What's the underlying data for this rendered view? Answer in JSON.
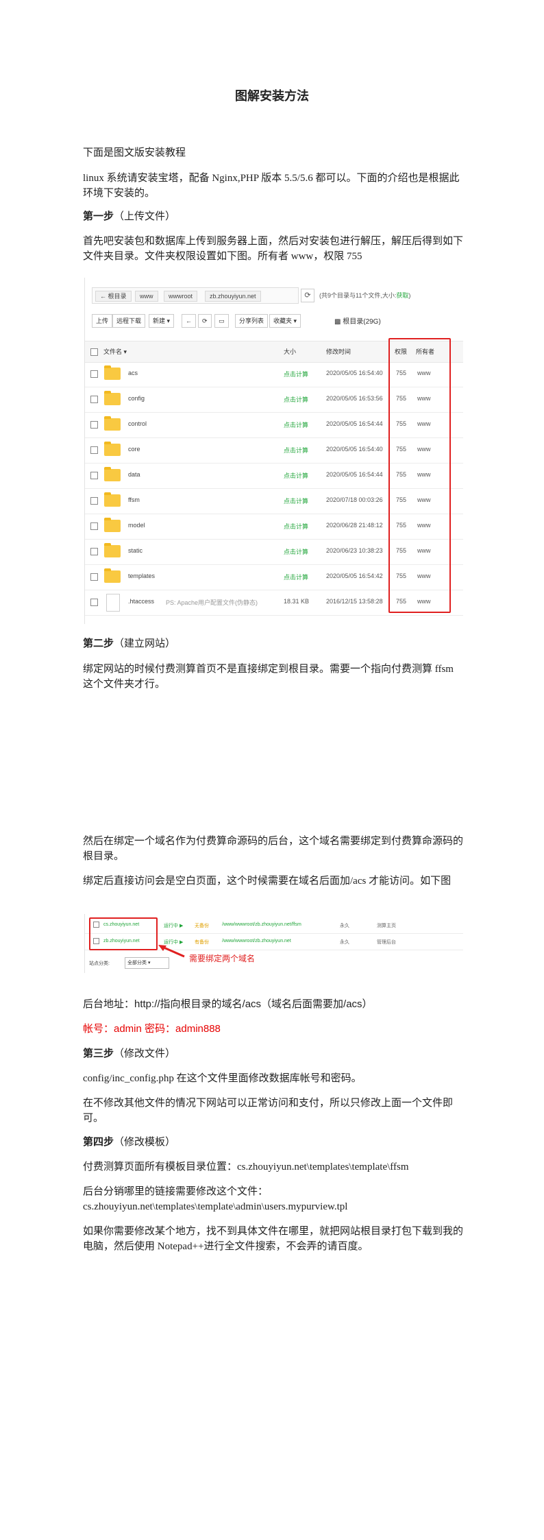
{
  "title": "图解安装方法",
  "intro": "下面是图文版安装教程",
  "env_line": "linux 系统请安装宝塔，配备 Nginx,PHP 版本 5.5/5.6 都可以。下面的介绍也是根据此环境下安装的。",
  "step1": {
    "label": "第一步",
    "sub": "（上传文件）",
    "desc": "首先吧安装包和数据库上传到服务器上面，然后对安装包进行解压，解压后得到如下文件夹目录。文件夹权限设置如下图。所有者 www，权限 755"
  },
  "file_manager": {
    "path": [
      "根目录",
      "www",
      "wwwroot",
      "zb.zhouyiyun.net"
    ],
    "summary_prefix": "(共9个目录与11个文件,大小:",
    "summary_link": "获取",
    "summary_suffix": ")",
    "toolbar": [
      "上传",
      "远程下载",
      "新建 ▾",
      "分享列表",
      "收藏夹 ▾"
    ],
    "disk": "根目录(29G)",
    "headers": {
      "name": "文件名",
      "size": "大小",
      "modified": "修改时间",
      "perm": "权限",
      "owner": "所有者"
    },
    "rows": [
      {
        "name": "acs",
        "size": "点击计算",
        "time": "2020/05/05 16:54:40",
        "perm": "755",
        "owner": "www"
      },
      {
        "name": "config",
        "size": "点击计算",
        "time": "2020/05/05 16:53:56",
        "perm": "755",
        "owner": "www"
      },
      {
        "name": "control",
        "size": "点击计算",
        "time": "2020/05/05 16:54:44",
        "perm": "755",
        "owner": "www"
      },
      {
        "name": "core",
        "size": "点击计算",
        "time": "2020/05/05 16:54:40",
        "perm": "755",
        "owner": "www"
      },
      {
        "name": "data",
        "size": "点击计算",
        "time": "2020/05/05 16:54:44",
        "perm": "755",
        "owner": "www"
      },
      {
        "name": "ffsm",
        "size": "点击计算",
        "time": "2020/07/18 00:03:26",
        "perm": "755",
        "owner": "www"
      },
      {
        "name": "model",
        "size": "点击计算",
        "time": "2020/06/28 21:48:12",
        "perm": "755",
        "owner": "www"
      },
      {
        "name": "static",
        "size": "点击计算",
        "time": "2020/06/23 10:38:23",
        "perm": "755",
        "owner": "www"
      },
      {
        "name": "templates",
        "size": "点击计算",
        "time": "2020/05/05 16:54:42",
        "perm": "755",
        "owner": "www"
      },
      {
        "name": ".htaccess",
        "desc": "PS: Apache用户配置文件(伪静态)",
        "size": "18.31 KB",
        "time": "2016/12/15 13:58:28",
        "perm": "755",
        "owner": "www"
      }
    ]
  },
  "step2": {
    "label": "第二步",
    "sub": "（建立网站）",
    "desc": "绑定网站的时候付费测算首页不是直接绑定到根目录。需要一个指向付费测算 ffsm 这个文件夹才行。",
    "desc2": "然后在绑定一个域名作为付费算命源码的后台，这个域名需要绑定到付费算命源码的根目录。",
    "desc3": "绑定后直接访问会是空白页面，这个时候需要在域名后面加/acs 才能访问。如下图"
  },
  "sites": {
    "rows": [
      {
        "domain": "cs.zhouyiyun.net",
        "status": "运行中 ▶",
        "backup": "无备份",
        "path": "/www/wwwroot/zb.zhouyiyun.net/ffsm",
        "expire": "永久",
        "note": "测算主页"
      },
      {
        "domain": "zb.zhouyiyun.net",
        "status": "运行中 ▶",
        "backup": "有备份",
        "path": "/www/wwwroot/zb.zhouyiyun.net",
        "expire": "永久",
        "note": "管理后台"
      }
    ],
    "classify_label": "站点分类:",
    "classify_value": "全部分类",
    "annotation": "需要绑定两个域名"
  },
  "backend": "后台地址：http://指向根目录的域名/acs（域名后面需要加/acs）",
  "credentials": "帐号：admin  密码：admin888",
  "step3": {
    "label": "第三步",
    "sub": "（修改文件）",
    "desc": "config/inc_config.php 在这个文件里面修改数据库帐号和密码。",
    "desc2": "在不修改其他文件的情况下网站可以正常访问和支付，所以只修改上面一个文件即可。"
  },
  "step4": {
    "label": "第四步",
    "sub": "（修改模板）",
    "desc": "付费测算页面所有模板目录位置：cs.zhouyiyun.net\\templates\\template\\ffsm",
    "desc2a": "后台分销哪里的链接需要修改这个文件：",
    "desc2b": "cs.zhouyiyun.net\\templates\\template\\admin\\users.mypurview.tpl",
    "desc3": "如果你需要修改某个地方，找不到具体文件在哪里，就把网站根目录打包下载到我的电脑，然后使用 Notepad++进行全文件搜索，不会弄的请百度。"
  },
  "colors": {
    "accent_green": "#20a53a",
    "highlight_red": "#e02020",
    "folder_yellow": "#f9c941"
  }
}
